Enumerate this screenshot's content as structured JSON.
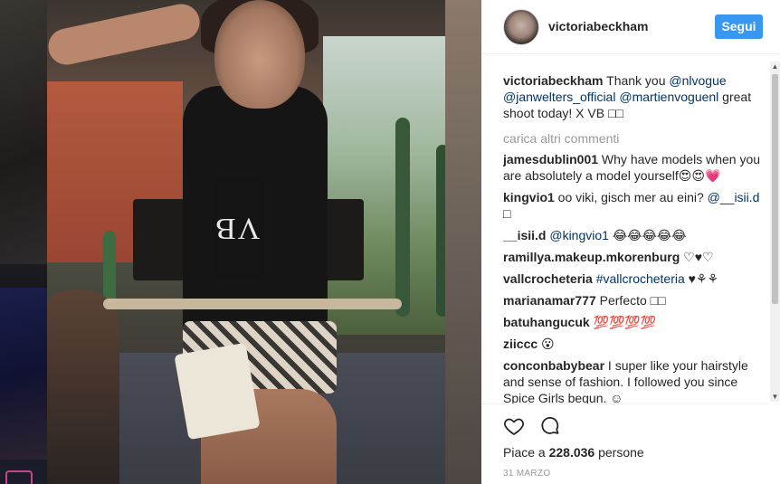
{
  "post": {
    "username": "victoriabeckham",
    "follow_label": "Segui",
    "phone_monogram": "VB"
  },
  "caption": {
    "author": "victoriabeckham",
    "text_1": " Thank you ",
    "mention_1": "@nlvogue",
    "mention_2": "@janwelters_official",
    "mention_3": "@martienvoguenl",
    "text_2": " great shoot today! X VB ",
    "emoji": "□□"
  },
  "load_more_label": "carica altri commenti",
  "comments": [
    {
      "author": "jamesdublin001",
      "text": " Why have models when you are absolutely a model yourself😍😍💗"
    },
    {
      "author": "kingvio1",
      "text": " oo viki, gisch mer au eini? ",
      "mention": "@__isii.d",
      "trail": " □"
    },
    {
      "author": "__isii.d",
      "mention": " @kingvio1",
      "text": " 😂😂😂😂😂"
    },
    {
      "author": "ramillya.makeup.mkorenburg",
      "text": " ♡♥♡"
    },
    {
      "author": "vallcrocheteria",
      "tag": " #vallcrocheteria",
      "text": " ♥⚘⚘"
    },
    {
      "author": "marianamar777",
      "text": " Perfecto □□"
    },
    {
      "author": "batuhangucuk",
      "text": " 💯💯💯💯"
    },
    {
      "author": "ziiccc",
      "text": " 😮"
    },
    {
      "author": "conconbabybear",
      "text": " I super like your hairstyle and sense of fashion. I followed you since Spice Girls begun. ☺"
    }
  ],
  "likes": {
    "prefix": "Piace a ",
    "count": "228.036",
    "suffix": " persone"
  },
  "date": "31 MARZO",
  "colors": {
    "accent": "#3897f0",
    "link": "#003569",
    "muted": "#999999"
  },
  "icons": [
    "heart-icon",
    "comment-icon"
  ]
}
